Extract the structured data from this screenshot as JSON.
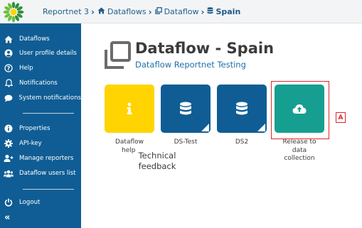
{
  "breadcrumb": {
    "items": [
      {
        "label": "Reportnet 3",
        "icon": "none"
      },
      {
        "label": "Dataflows",
        "icon": "home-icon"
      },
      {
        "label": "Dataflow",
        "icon": "clone-icon"
      },
      {
        "label": "Spain",
        "icon": "database-icon"
      }
    ]
  },
  "sidebar": {
    "items": [
      {
        "label": "Dataflows",
        "icon": "home-icon"
      },
      {
        "label": "User profile details",
        "icon": "user-circle-icon"
      },
      {
        "label": "Help",
        "icon": "question-circle-icon"
      },
      {
        "label": "Notifications",
        "icon": "bell-icon"
      },
      {
        "label": "System notifications",
        "icon": "comment-icon"
      },
      {
        "label": "Properties",
        "icon": "info-circle-icon"
      },
      {
        "label": "API-key",
        "icon": "gear-icon"
      },
      {
        "label": "Manage reporters",
        "icon": "user-plus-icon"
      },
      {
        "label": "Dataflow users list",
        "icon": "users-icon"
      },
      {
        "label": "Logout",
        "icon": "power-icon"
      }
    ],
    "collapse_glyph": "«"
  },
  "page": {
    "title": "Dataflow - Spain",
    "subtitle": "Dataflow Reportnet Testing"
  },
  "tiles": [
    {
      "label_line1": "Dataflow",
      "label_line2": "help",
      "icon": "info-icon",
      "color": "#ffd400"
    },
    {
      "label": "DS-Test",
      "icon": "database-icon",
      "color": "#0f5d94"
    },
    {
      "label": "DS2",
      "icon": "database-icon",
      "color": "#0f5d94"
    },
    {
      "label_line1": "Release to",
      "label_line2": "data",
      "label_line3": "collection",
      "icon": "cloud-upload-icon",
      "color": "#169f90"
    }
  ],
  "feedback": {
    "line1": "Technical",
    "line2": "feedback"
  },
  "annotation": {
    "marker": "A",
    "color": "#e0262b"
  },
  "colors": {
    "sidebar": "#0f5d94",
    "accent": "#1f6fa7",
    "help_tile": "#ffd400",
    "dataset_tile": "#0f5d94",
    "release_tile": "#169f90"
  }
}
